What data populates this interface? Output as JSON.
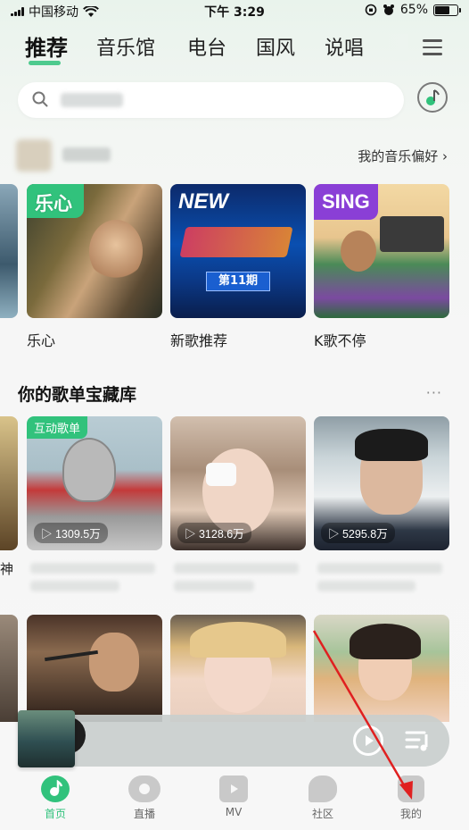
{
  "status_bar": {
    "carrier": "中国移动",
    "time": "下午 3:29",
    "battery": "65%",
    "battery_level": 0.65
  },
  "tabs": [
    {
      "label": "推荐",
      "active": true
    },
    {
      "label": "音乐馆"
    },
    {
      "label": "电台"
    },
    {
      "label": "国风"
    },
    {
      "label": "说唱"
    }
  ],
  "search": {
    "placeholder": ""
  },
  "preference_link": "我的音乐偏好 ›",
  "featured": [
    {
      "tag": "乐心",
      "label": "乐心"
    },
    {
      "tag": "NEW",
      "label": "新歌推荐",
      "art_text": "第11期"
    },
    {
      "tag": "SING",
      "label": "K歌不停"
    }
  ],
  "playlist_section": {
    "title": "你的歌单宝藏库",
    "more": "···",
    "items": [
      {
        "badge": "互动歌单",
        "plays": "▷ 1309.5万"
      },
      {
        "plays": "▷ 3128.6万"
      },
      {
        "plays": "▷ 5295.8万"
      }
    ],
    "left_cut_label": "神"
  },
  "bottom_nav": [
    {
      "label": "首页",
      "active": true
    },
    {
      "label": "直播"
    },
    {
      "label": "MV"
    },
    {
      "label": "社区"
    },
    {
      "label": "我的"
    }
  ],
  "colors": {
    "accent": "#31c27c",
    "annotation": "#e02020"
  }
}
